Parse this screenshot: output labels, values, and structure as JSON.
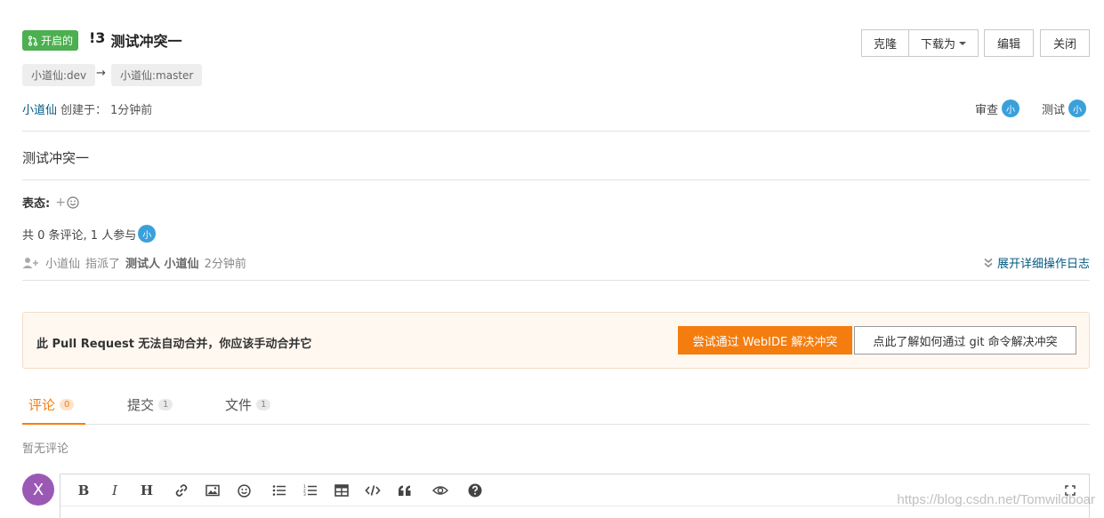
{
  "header": {
    "status_label": "开启的",
    "pr_number": "!3",
    "pr_title": "测试冲突一",
    "actions": {
      "clone": "克隆",
      "download": "下载为",
      "edit": "编辑",
      "close": "关闭"
    }
  },
  "branches": {
    "source": "小道仙:dev",
    "arrow": "→",
    "target": "小道仙:master"
  },
  "meta": {
    "author": "小道仙",
    "created_label": "创建于：",
    "created_time": "1分钟前"
  },
  "reviewers": [
    {
      "label": "审查",
      "avatar": "小"
    },
    {
      "label": "测试",
      "avatar": "小"
    }
  ],
  "description": "测试冲突一",
  "reactions": {
    "label": "表态:",
    "add": "+"
  },
  "comment_summary": {
    "text": "共 0 条评论, 1 人参与",
    "avatar": "小"
  },
  "activity": {
    "actor": "小道仙",
    "action": "指派了",
    "targets": "测试人 小道仙",
    "time": "2分钟前",
    "expand_log": "展开详细操作日志"
  },
  "merge_panel": {
    "message": "此 Pull Request 无法自动合并，你应该手动合并它",
    "webide_button": "尝试通过 WebIDE 解决冲突",
    "git_button": "点此了解如何通过 git 命令解决冲突"
  },
  "tabs": [
    {
      "label": "评论",
      "count": "0"
    },
    {
      "label": "提交",
      "count": "1"
    },
    {
      "label": "文件",
      "count": "1"
    }
  ],
  "no_comments": "暂无评论",
  "editor": {
    "user_avatar": "X"
  },
  "watermark": "https://blog.csdn.net/Tomwildboar",
  "colors": {
    "status_green": "#4caf50",
    "accent_orange": "#f57d0f",
    "link_blue": "#005980",
    "avatar_blue": "#3aa0db",
    "user_purple": "#9b59b6"
  }
}
